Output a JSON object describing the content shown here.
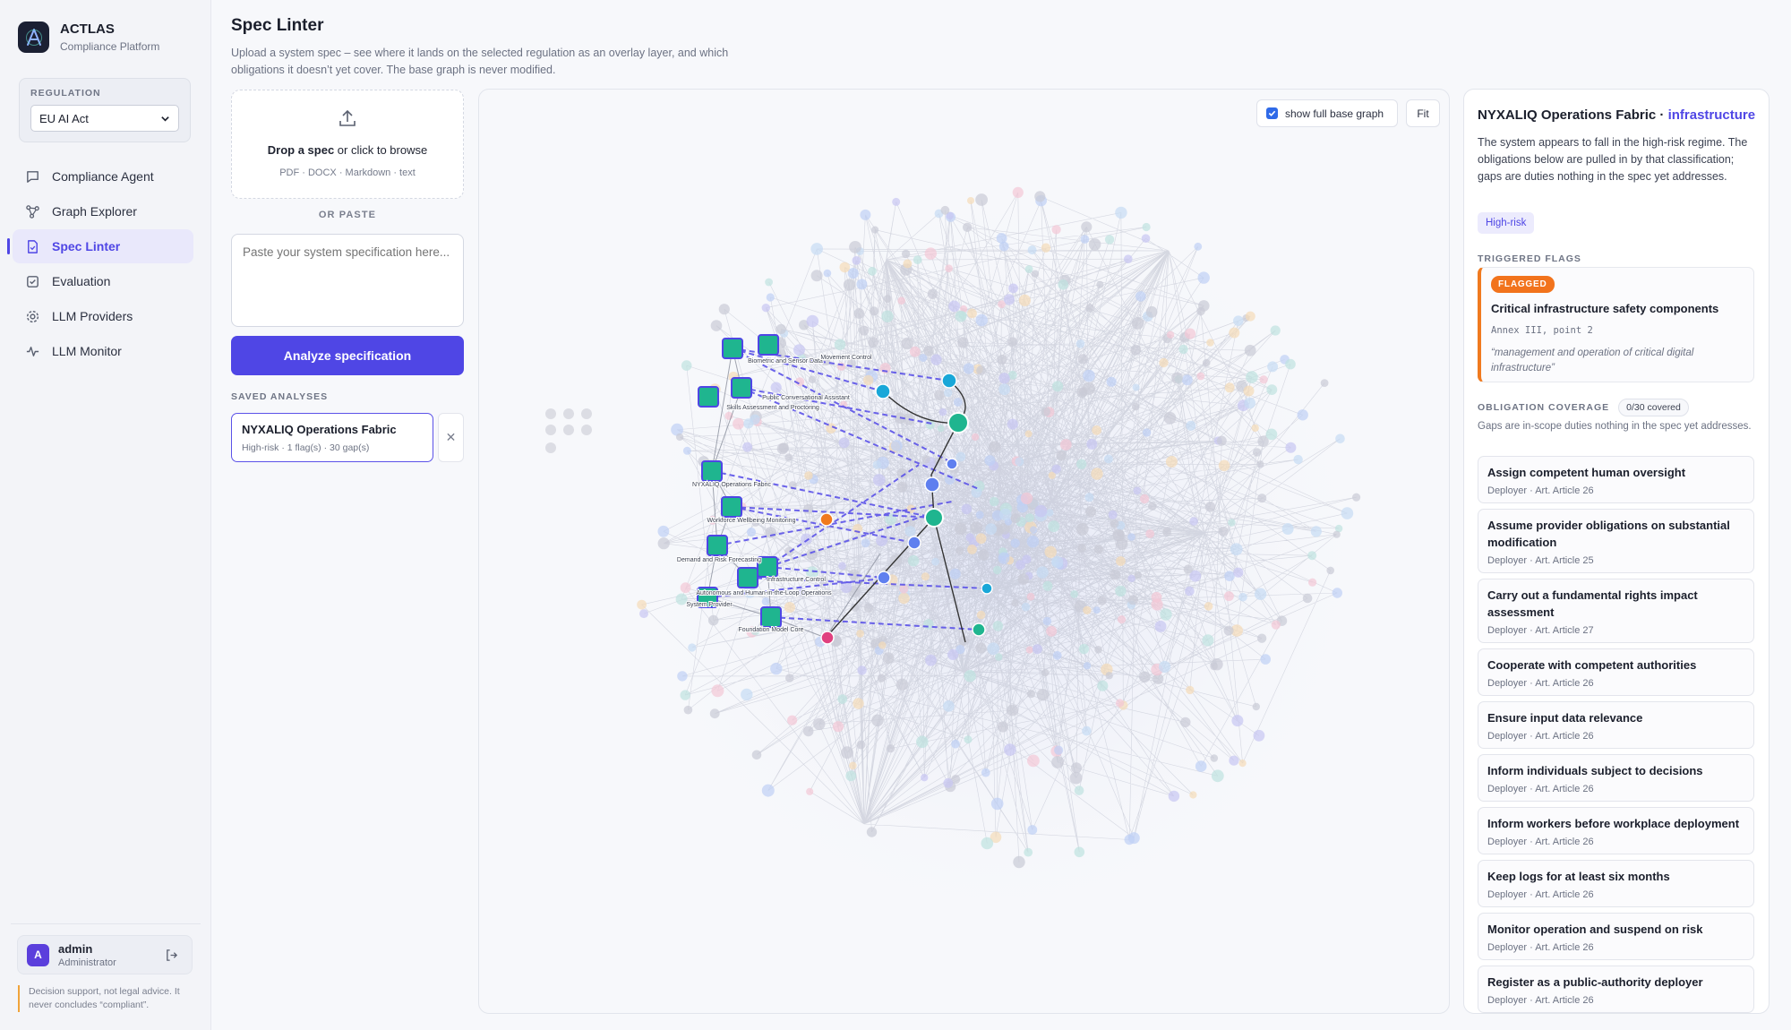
{
  "brand": {
    "name": "ACTLAS",
    "subtitle": "Compliance Platform"
  },
  "regulation": {
    "label": "REGULATION",
    "selected": "EU AI Act"
  },
  "nav": [
    {
      "label": "Compliance Agent",
      "icon": "chat-icon"
    },
    {
      "label": "Graph Explorer",
      "icon": "graph-icon"
    },
    {
      "label": "Spec Linter",
      "icon": "document-icon",
      "active": true
    },
    {
      "label": "Evaluation",
      "icon": "checkbox-icon"
    },
    {
      "label": "LLM Providers",
      "icon": "gear-icon"
    },
    {
      "label": "LLM Monitor",
      "icon": "activity-icon"
    }
  ],
  "user": {
    "initial": "A",
    "name": "admin",
    "role": "Administrator"
  },
  "disclaimer": "Decision support, not legal advice. It never concludes “compliant”.",
  "page": {
    "title": "Spec Linter",
    "description": "Upload a system spec – see where it lands on the selected regulation as an overlay layer, and which obligations it doesn’t yet cover. The base graph is never modified."
  },
  "upload": {
    "drop_bold": "Drop a spec",
    "drop_rest": " or click to browse",
    "formats": "PDF · DOCX · Markdown · text",
    "or_paste": "OR PASTE",
    "paste_placeholder": "Paste your system specification here...",
    "analyze_label": "Analyze specification"
  },
  "saved": {
    "label": "SAVED ANALYSES",
    "items": [
      {
        "name": "NYXALIQ Operations Fabric",
        "meta": "High-risk · 1 flag(s) · 30 gap(s)"
      }
    ]
  },
  "graph_controls": {
    "show_full_label": "show full base graph",
    "show_full_checked": true,
    "fit_label": "Fit"
  },
  "graph_nodes": [
    {
      "label": "Biometric and Sensor Data"
    },
    {
      "label": "Movement Control"
    },
    {
      "label": "Public Conversational Assistant"
    },
    {
      "label": "Skills Assessment and Proctoring"
    },
    {
      "label": "NYXALIQ Operations Fabric"
    },
    {
      "label": "Workforce Wellbeing Monitoring"
    },
    {
      "label": "Demand and Risk Forecasting"
    },
    {
      "label": "Infrastructure Control"
    },
    {
      "label": "Autonomous and Human-in-the-Loop Operations"
    },
    {
      "label": "System Provider"
    },
    {
      "label": "Foundation Model Core"
    }
  ],
  "details": {
    "system_name": "NYXALIQ Operations Fabric",
    "separator": " · ",
    "sector": "infrastructure",
    "summary": "The system appears to fall in the high-risk regime. The obligations below are pulled in by that classification; gaps are duties nothing in the spec yet addresses.",
    "risk_badge": "High-risk",
    "triggered_label": "TRIGGERED FLAGS",
    "flag": {
      "status": "FLAGGED",
      "title": "Critical infrastructure safety components",
      "reference": "Annex III, point 2",
      "quote": "“management and operation of critical digital infrastructure”"
    },
    "coverage_label": "OBLIGATION COVERAGE",
    "coverage_count": "0/30 covered",
    "coverage_note": "Gaps are in-scope duties nothing in the spec yet addresses.",
    "obligations": [
      {
        "title": "Assign competent human oversight",
        "meta": "Deployer · Art. Article 26"
      },
      {
        "title": "Assume provider obligations on substantial modification",
        "meta": "Deployer · Art. Article 25"
      },
      {
        "title": "Carry out a fundamental rights impact assessment",
        "meta": "Deployer · Art. Article 27"
      },
      {
        "title": "Cooperate with competent authorities",
        "meta": "Deployer · Art. Article 26"
      },
      {
        "title": "Ensure input data relevance",
        "meta": "Deployer · Art. Article 26"
      },
      {
        "title": "Inform individuals subject to decisions",
        "meta": "Deployer · Art. Article 26"
      },
      {
        "title": "Inform workers before workplace deployment",
        "meta": "Deployer · Art. Article 26"
      },
      {
        "title": "Keep logs for at least six months",
        "meta": "Deployer · Art. Article 26"
      },
      {
        "title": "Monitor operation and suspend on risk",
        "meta": "Deployer · Art. Article 26"
      },
      {
        "title": "Register as a public-authority deployer",
        "meta": "Deployer · Art. Article 26"
      }
    ]
  },
  "colors": {
    "accent": "#4f46e5",
    "flag": "#f2731c",
    "spec_node": "#1fb58f",
    "graph_edge": "#5b52e8"
  }
}
